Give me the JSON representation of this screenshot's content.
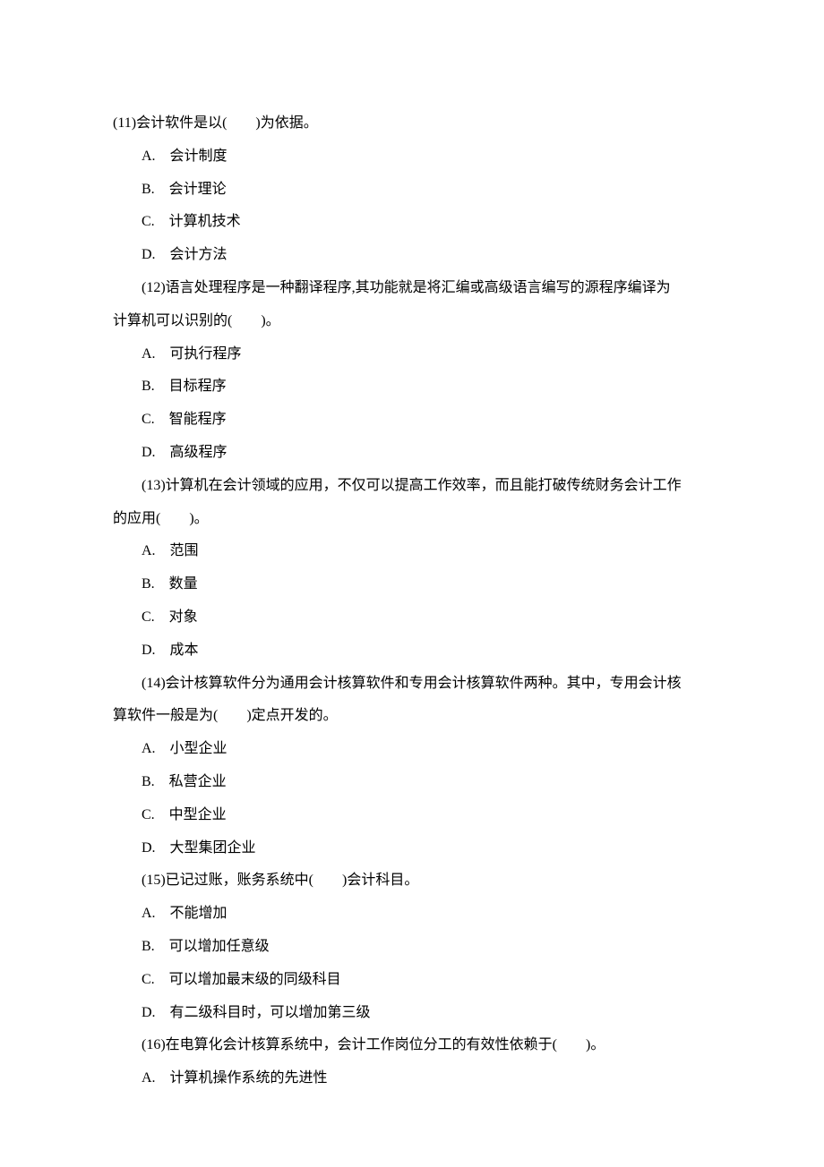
{
  "questions": [
    {
      "stem": "(11)会计软件是以(　　)为依据。",
      "indent": false,
      "options": [
        "A.　会计制度",
        "B.　会计理论",
        "C.　计算机技术",
        "D.　会计方法"
      ]
    },
    {
      "stem": "(12)语言处理程序是一种翻译程序,其功能就是将汇编或高级语言编写的源程序编译为",
      "indent": true,
      "cont": "计算机可以识别的(　　)。",
      "options": [
        "A.　可执行程序",
        "B.　目标程序",
        "C.　智能程序",
        "D.　高级程序"
      ]
    },
    {
      "stem": "(13)计算机在会计领域的应用，不仅可以提高工作效率，而且能打破传统财务会计工作",
      "indent": true,
      "cont": "的应用(　　)。",
      "options": [
        "A.　范围",
        "B.　数量",
        "C.　对象",
        "D.　成本"
      ]
    },
    {
      "stem": "(14)会计核算软件分为通用会计核算软件和专用会计核算软件两种。其中，专用会计核",
      "indent": true,
      "cont": "算软件一般是为(　　)定点开发的。",
      "options": [
        "A.　小型企业",
        "B.　私营企业",
        "C.　中型企业",
        "D.　大型集团企业"
      ]
    },
    {
      "stem": "(15)已记过账，账务系统中(　　)会计科目。",
      "indent": true,
      "options": [
        "A.　不能增加",
        "B.　可以增加任意级",
        "C.　可以增加最末级的同级科目",
        "D.　有二级科目时，可以增加第三级"
      ]
    },
    {
      "stem": "(16)在电算化会计核算系统中，会计工作岗位分工的有效性依赖于(　　)。",
      "indent": true,
      "options": [
        "A.　计算机操作系统的先进性"
      ]
    }
  ]
}
